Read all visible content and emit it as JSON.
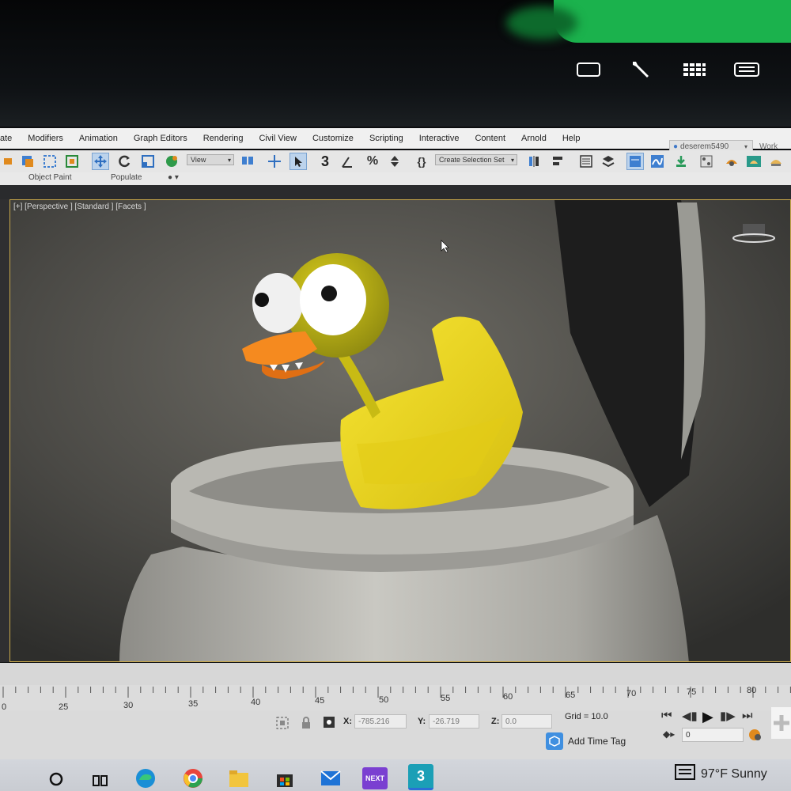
{
  "menubar": {
    "items": [
      "ate",
      "Modifiers",
      "Animation",
      "Graph Editors",
      "Rendering",
      "Civil View",
      "Customize",
      "Scripting",
      "Interactive",
      "Content",
      "Arnold",
      "Help"
    ],
    "user": "deserem5490",
    "workspace": "Work"
  },
  "toolbar": {
    "view_dropdown": "View",
    "selection_set_dropdown": "Create Selection Set",
    "snap_label": "3"
  },
  "ribbon": {
    "object_paint": "Object Paint",
    "populate": "Populate"
  },
  "viewport": {
    "label": "[+] [Perspective ] [Standard ] [Facets ]"
  },
  "timeline": {
    "ticks": [
      "0",
      "25",
      "30",
      "35",
      "40",
      "45",
      "50",
      "55",
      "60",
      "65",
      "70",
      "75",
      "80"
    ]
  },
  "status": {
    "x_label": "X:",
    "x_value": "-785.216",
    "y_label": "Y:",
    "y_value": "-26.719",
    "z_label": "Z:",
    "z_value": "0.0",
    "grid": "Grid = 10.0",
    "add_time_tag": "Add Time Tag",
    "frame_value": "0"
  },
  "taskbar": {
    "next_label": "NEXT",
    "max_label": "3",
    "weather": "97°F Sunny"
  },
  "colors": {
    "duck_yellow": "#f2dc1c",
    "beak_orange": "#f58a1f",
    "viewport_border": "#c8a84b",
    "taskbar": "#cdd0d6"
  }
}
